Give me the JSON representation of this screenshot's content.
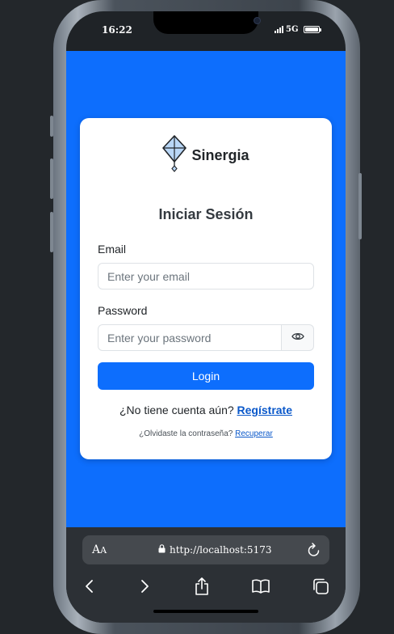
{
  "status_bar": {
    "time": "16:22",
    "network": "5G"
  },
  "app": {
    "brand_name": "Sinergia",
    "heading": "Iniciar Sesión",
    "email_label": "Email",
    "email_placeholder": "Enter your email",
    "password_label": "Password",
    "password_placeholder": "Enter your password",
    "login_label": "Login",
    "signup_prompt": "¿No tiene cuenta aún?",
    "signup_link": "Regístrate",
    "forgot_prompt": "¿Olvidaste la contraseña?",
    "forgot_link": "Recuperar"
  },
  "browser": {
    "aa_label_large": "A",
    "aa_label_small": "A",
    "url": "http://localhost:5173"
  },
  "icons": {
    "logo": "kite-icon",
    "password_toggle": "eye-icon",
    "lock": "lock-icon",
    "reload": "reload-icon",
    "back": "chevron-left-icon",
    "forward": "chevron-right-icon",
    "share": "share-icon",
    "bookmarks": "book-icon",
    "tabs": "tabs-icon"
  },
  "colors": {
    "primary": "#0d6efd",
    "link": "#0a58ca",
    "page_bg": "#23272b"
  }
}
